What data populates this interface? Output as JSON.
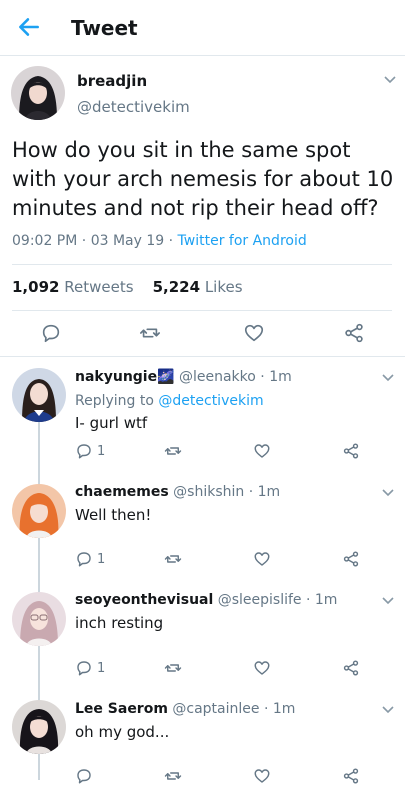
{
  "header": {
    "title": "Tweet"
  },
  "tweet": {
    "name": "breadjin",
    "handle": "@detectivekim",
    "text": "How do you sit in the same spot with your arch nemesis for about 10 minutes and not rip their head off?",
    "time": "09:02 PM",
    "date": "03 May 19",
    "sep1": "·",
    "sep2": "·",
    "source": "Twitter for Android",
    "retweets_count": "1,092",
    "retweets_label": "Retweets",
    "likes_count": "5,224",
    "likes_label": "Likes"
  },
  "replies": [
    {
      "name": "nakyungie🌌",
      "handle": "@leenakko",
      "time": "· 1m",
      "replying_prefix": "Replying to",
      "replying_to": "@detectivekim",
      "text": "I- gurl wtf",
      "reply_count": "1"
    },
    {
      "name": "chaememes",
      "handle": "@shikshin",
      "time": "· 1m",
      "text": "Well then!",
      "reply_count": "1"
    },
    {
      "name": "seoyeonthevisual",
      "handle": "@sleepislife",
      "time": "· 1m",
      "text": "inch resting",
      "reply_count": "1"
    },
    {
      "name": "Lee Saerom",
      "handle": "@captainlee",
      "time": "· 1m",
      "text": "oh my god...",
      "reply_count": ""
    }
  ],
  "colors": {
    "accent": "#1da1f2",
    "secondary_text": "#657786",
    "divider": "#e1e8ed"
  },
  "icons": [
    "back-arrow-icon",
    "chevron-down-icon",
    "reply-icon",
    "retweet-icon",
    "like-icon",
    "share-icon"
  ]
}
